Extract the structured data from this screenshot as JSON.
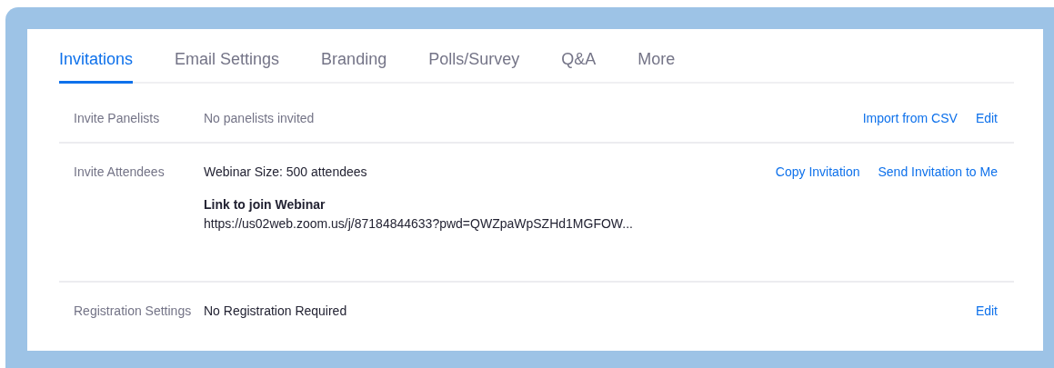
{
  "tabs": [
    {
      "label": "Invitations",
      "selected": true
    },
    {
      "label": "Email Settings",
      "selected": false
    },
    {
      "label": "Branding",
      "selected": false
    },
    {
      "label": "Polls/Survey",
      "selected": false
    },
    {
      "label": "Q&A",
      "selected": false
    },
    {
      "label": "More",
      "selected": false
    }
  ],
  "sections": [
    {
      "label": "Invite Panelists",
      "kind": "muted",
      "value": "No panelists invited",
      "actions": [
        "Import from CSV",
        "Edit"
      ]
    },
    {
      "label": "Invite Attendees",
      "kind": "link",
      "value": "Webinar Size: 500 attendees",
      "link_title": "Link to join Webinar",
      "link_url": "https://us02web.zoom.us/j/87184844633?pwd=QWZpaWpSZHd1MGFOW...",
      "actions": [
        "Copy Invitation",
        "Send Invitation to Me"
      ]
    },
    {
      "label": "Registration Settings",
      "kind": "plain",
      "value": "No Registration Required",
      "actions": [
        "Edit"
      ]
    }
  ]
}
